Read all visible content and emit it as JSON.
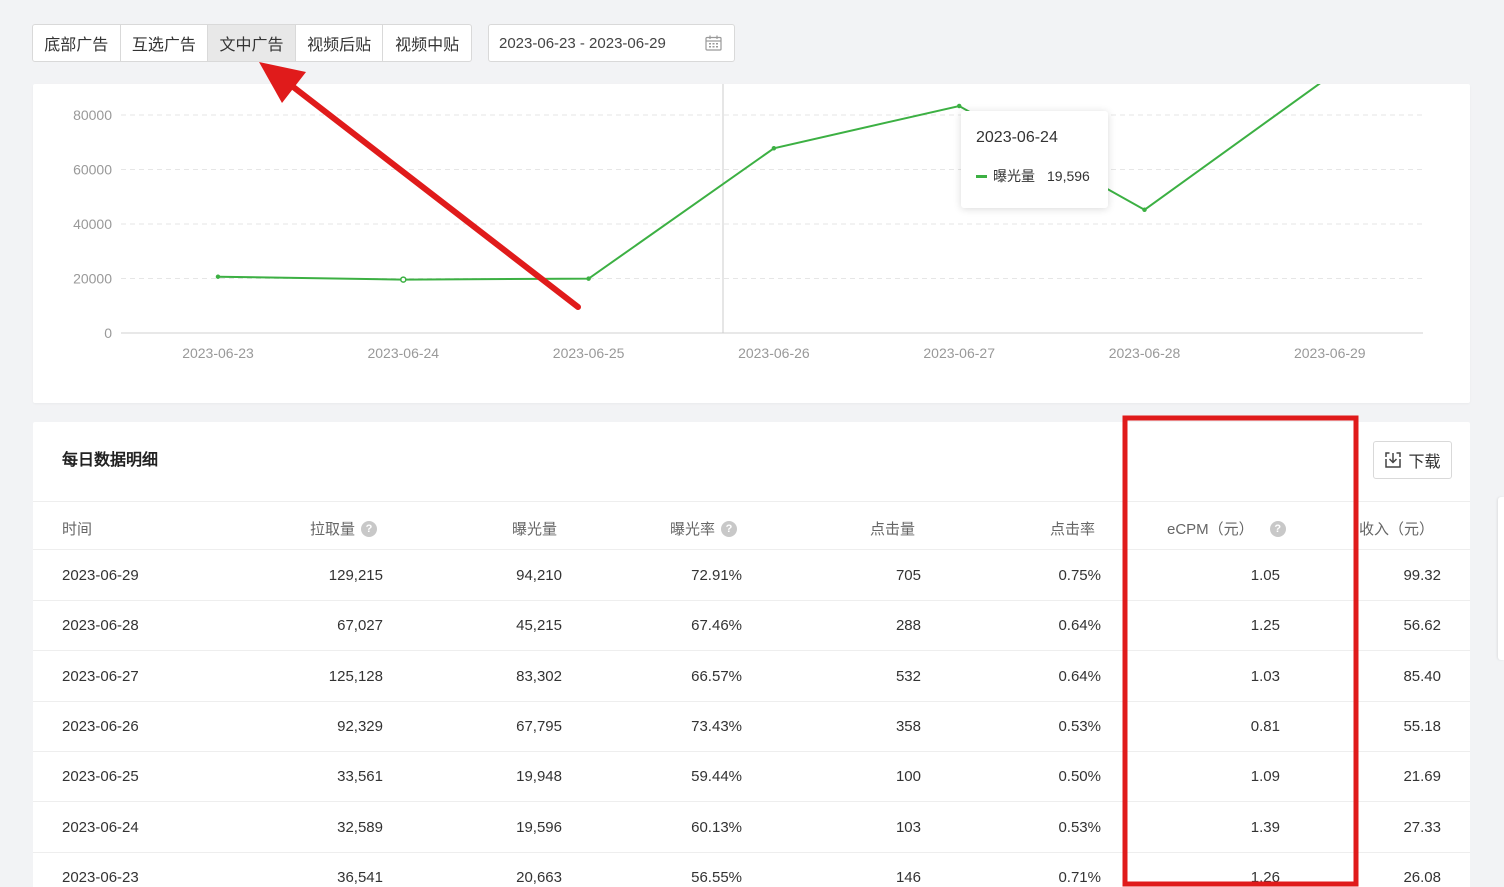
{
  "tabs": [
    {
      "label": "底部广告",
      "active": false
    },
    {
      "label": "互选广告",
      "active": false
    },
    {
      "label": "文中广告",
      "active": true
    },
    {
      "label": "视频后贴",
      "active": false
    },
    {
      "label": "视频中贴",
      "active": false
    }
  ],
  "date_range": {
    "value": "2023-06-23 - 2023-06-29",
    "icon": "calendar-icon"
  },
  "chart_data": {
    "type": "line",
    "categories": [
      "2023-06-23",
      "2023-06-24",
      "2023-06-25",
      "2023-06-26",
      "2023-06-27",
      "2023-06-28",
      "2023-06-29"
    ],
    "series": [
      {
        "name": "曝光量",
        "values": [
          20663,
          19596,
          19948,
          67795,
          83302,
          45215,
          94210
        ],
        "color": "#3cb043"
      }
    ],
    "y_ticks": [
      "0",
      "20000",
      "40000",
      "60000",
      "80000"
    ],
    "ylim": [
      0,
      80000
    ],
    "grid": true,
    "tooltip": {
      "date": "2023-06-24",
      "series_name": "曝光量",
      "value": "19,596"
    }
  },
  "table": {
    "title": "每日数据明细",
    "download_label": "下载",
    "columns": [
      {
        "label": "时间",
        "help": false
      },
      {
        "label": "拉取量",
        "help": true
      },
      {
        "label": "曝光量",
        "help": false
      },
      {
        "label": "曝光率",
        "help": true
      },
      {
        "label": "点击量",
        "help": false
      },
      {
        "label": "点击率",
        "help": false
      },
      {
        "label": "eCPM（元）",
        "help": true
      },
      {
        "label": "收入（元）",
        "help": false
      }
    ],
    "rows": [
      [
        "2023-06-29",
        "129,215",
        "94,210",
        "72.91%",
        "705",
        "0.75%",
        "1.05",
        "99.32"
      ],
      [
        "2023-06-28",
        "67,027",
        "45,215",
        "67.46%",
        "288",
        "0.64%",
        "1.25",
        "56.62"
      ],
      [
        "2023-06-27",
        "125,128",
        "83,302",
        "66.57%",
        "532",
        "0.64%",
        "1.03",
        "85.40"
      ],
      [
        "2023-06-26",
        "92,329",
        "67,795",
        "73.43%",
        "358",
        "0.53%",
        "0.81",
        "55.18"
      ],
      [
        "2023-06-25",
        "33,561",
        "19,948",
        "59.44%",
        "100",
        "0.50%",
        "1.09",
        "21.69"
      ],
      [
        "2023-06-24",
        "32,589",
        "19,596",
        "60.13%",
        "103",
        "0.53%",
        "1.39",
        "27.33"
      ],
      [
        "2023-06-23",
        "36,541",
        "20,663",
        "56.55%",
        "146",
        "0.71%",
        "1.26",
        "26.08"
      ]
    ]
  },
  "annotation": {
    "arrow_color": "#e01b1b",
    "box_color": "#e01b1b"
  }
}
